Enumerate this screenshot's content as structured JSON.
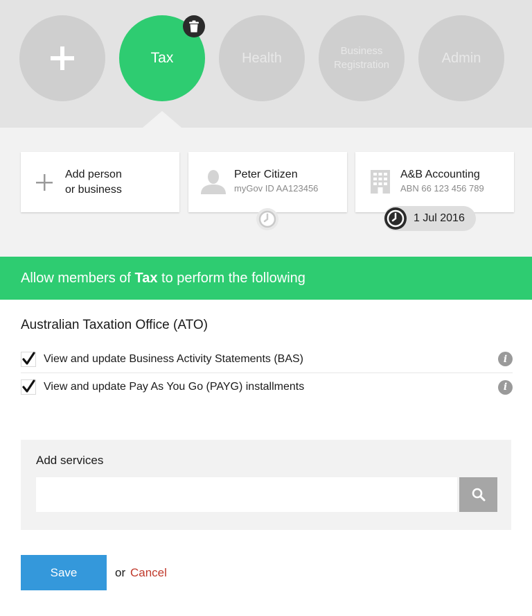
{
  "groups": [
    {
      "label": ""
    },
    {
      "label": "Tax"
    },
    {
      "label": "Health"
    },
    {
      "label": "Business Registration"
    },
    {
      "label": "Admin"
    }
  ],
  "members": {
    "add_card": {
      "line1": "Add person",
      "line2": "or business"
    },
    "person": {
      "name": "Peter Citizen",
      "id_text": "myGov ID AA123456"
    },
    "business": {
      "name": "A&B Accounting",
      "abn": "ABN 66 123 456 789",
      "date": "1 Jul 2016"
    }
  },
  "banner": {
    "prefix": "Allow members of ",
    "group": "Tax",
    "suffix": " to perform the following"
  },
  "section": {
    "title": "Australian Taxation Office (ATO)"
  },
  "permissions": [
    {
      "label": "View and update Business Activity Statements (BAS)",
      "checked": true
    },
    {
      "label": "View and update Pay As You Go (PAYG) installments",
      "checked": true
    }
  ],
  "services": {
    "label": "Add services",
    "value": "",
    "placeholder": ""
  },
  "actions": {
    "save": "Save",
    "or": "or",
    "cancel": "Cancel"
  },
  "colors": {
    "accent_green": "#2ecc71",
    "save_blue": "#3498db",
    "cancel_red": "#c0392b"
  }
}
